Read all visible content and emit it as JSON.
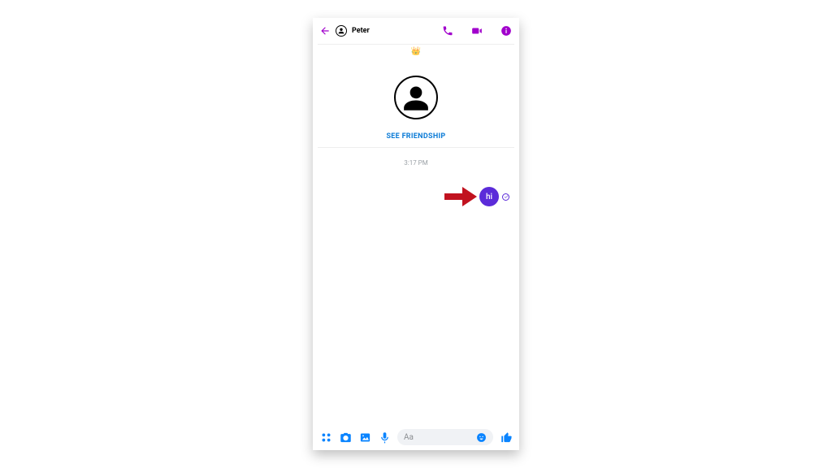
{
  "header": {
    "contact_name": "Peter"
  },
  "profile": {
    "friendship_label": "SEE FRIENDSHIP"
  },
  "conversation": {
    "timestamp": "3:17 PM",
    "outgoing_message": "hi"
  },
  "composer": {
    "placeholder": "Aa"
  },
  "colors": {
    "accent_purple": "#a100cc",
    "message_bubble": "#5b2bd9",
    "action_blue": "#0a84ff",
    "link_blue": "#0a7ad6"
  }
}
